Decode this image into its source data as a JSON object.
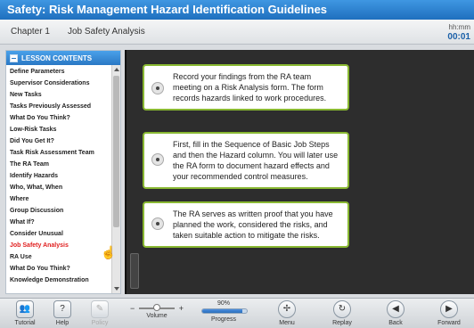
{
  "title": "Safety: Risk Management Hazard Identification Guidelines",
  "header": {
    "chapter": "Chapter 1",
    "chapter_title": "Job Safety Analysis",
    "timer_label": "hh:mm",
    "timer_value": "00:01"
  },
  "sidebar": {
    "heading": "LESSON CONTENTS",
    "items": [
      "Define Parameters",
      "Supervisor Considerations",
      "New Tasks",
      "Tasks Previously Assessed",
      "What Do You Think?",
      "Low-Risk Tasks",
      "Did You Get It?",
      "Task Risk Assessment Team",
      "The RA Team",
      "Identify Hazards",
      "Who, What, When",
      "Where",
      "Group Discussion",
      "What If?",
      "Consider Unusual",
      "Job Safety Analysis",
      "RA Use",
      "What Do You Think?",
      "Knowledge Demonstration"
    ],
    "active_index": 15
  },
  "cards": [
    "Record your findings from the RA team meeting on a Risk Analysis form. The form records hazards linked to work procedures.",
    "First, fill in the Sequence of Basic Job Steps and then the Hazard column. You will later use the RA form to document hazard effects and your recommended control measures.",
    "The RA serves as written proof that you have planned the work, considered the risks, and taken suitable action to mitigate the risks."
  ],
  "toolbar": {
    "tutorial": "Tutorial",
    "help": "Help",
    "policy": "Policy",
    "volume": "Volume",
    "progress_label": "Progress",
    "progress_value": "90%",
    "progress_fraction": 0.9,
    "menu": "Menu",
    "replay": "Replay",
    "back": "Back",
    "forward": "Forward",
    "icons": {
      "tutorial": "tutorial-icon",
      "help": "help-icon",
      "policy": "policy-icon",
      "menu": "menu-icon",
      "replay": "replay-icon",
      "back": "back-icon",
      "forward": "forward-icon"
    }
  },
  "colors": {
    "accent_blue": "#2a78c4",
    "active_item": "#e02020",
    "card_border": "#89b832",
    "content_bg": "#2d2d2d"
  }
}
